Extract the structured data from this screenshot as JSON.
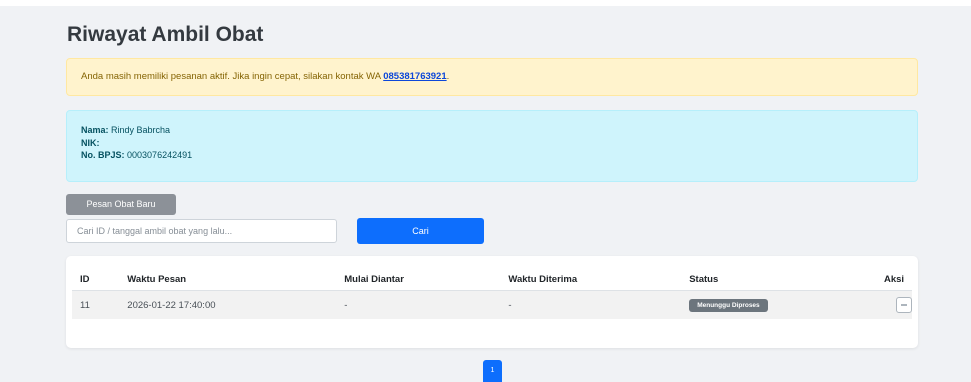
{
  "page": {
    "title": "Riwayat Ambil Obat"
  },
  "alert_warning": {
    "text": "Anda masih memiliki pesanan aktif. Jika ingin cepat, silakan kontak WA ",
    "wa_number": "085381763921",
    "suffix": "."
  },
  "patient": {
    "name_label": "Nama:",
    "name_value": "Rindy Babrcha",
    "nik_label": "NIK:",
    "nik_value": "",
    "bpjs_label": "No. BPJS:",
    "bpjs_value": "0003076242491"
  },
  "actions": {
    "new_order_label": "Pesan Obat Baru",
    "search_placeholder": "Cari ID / tanggal ambil obat yang lalu...",
    "search_button_label": "Cari"
  },
  "table": {
    "headers": [
      "ID",
      "Waktu Pesan",
      "Mulai Diantar",
      "Waktu Diterima",
      "Status",
      "Aksi"
    ],
    "rows": [
      {
        "id": "11",
        "waktu_pesan": "2026-01-22 17:40:00",
        "mulai_diantar": "-",
        "waktu_diterima": "-",
        "status": "Menunggu Diproses",
        "aksi_icon": "minus-icon"
      }
    ]
  },
  "pagination": {
    "current_page": "1"
  },
  "colors": {
    "primary": "#0d6efd",
    "warning_bg": "#fff3cd",
    "info_bg": "#cff4fc",
    "badge": "#6c757d"
  }
}
